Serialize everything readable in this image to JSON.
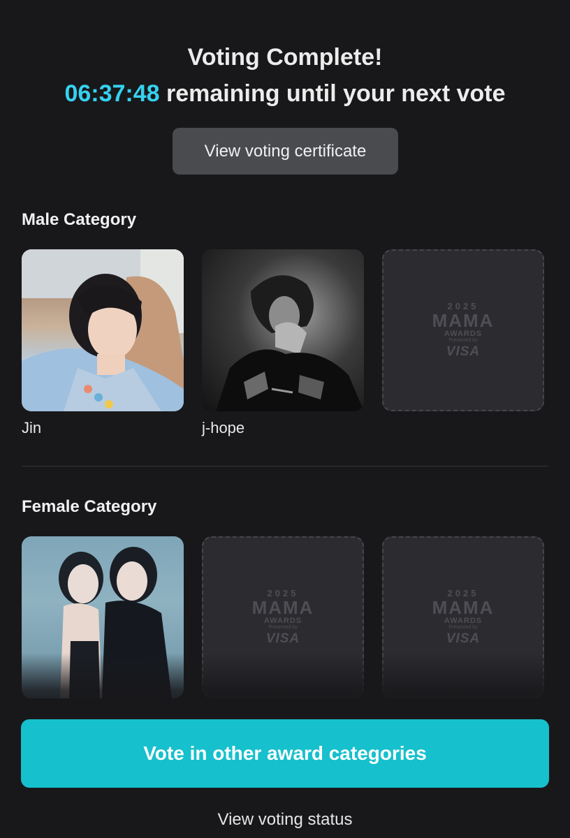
{
  "header": {
    "title": "Voting Complete!",
    "countdown": "06:37:48",
    "countdown_suffix": " remaining until your next vote"
  },
  "buttons": {
    "certificate": "View voting certificate",
    "vote_other": "Vote in other award categories",
    "status": "View voting status"
  },
  "sections": {
    "male": {
      "title": "Male Category",
      "cards": [
        {
          "label": "Jin",
          "filled": true
        },
        {
          "label": "j-hope",
          "filled": true
        },
        {
          "label": "",
          "filled": false
        }
      ]
    },
    "female": {
      "title": "Female Category",
      "cards": [
        {
          "label": "",
          "filled": true
        },
        {
          "label": "",
          "filled": false
        },
        {
          "label": "",
          "filled": false
        }
      ]
    }
  },
  "placeholder_logo": {
    "year": "2025",
    "name": "MAMA",
    "sub": "AWARDS",
    "presented": "Presented by",
    "sponsor": "VISA"
  },
  "colors": {
    "background": "#18181b",
    "accent": "#35d2f0",
    "primary_button": "#16c0cd",
    "secondary_button": "#4a4b4f"
  }
}
